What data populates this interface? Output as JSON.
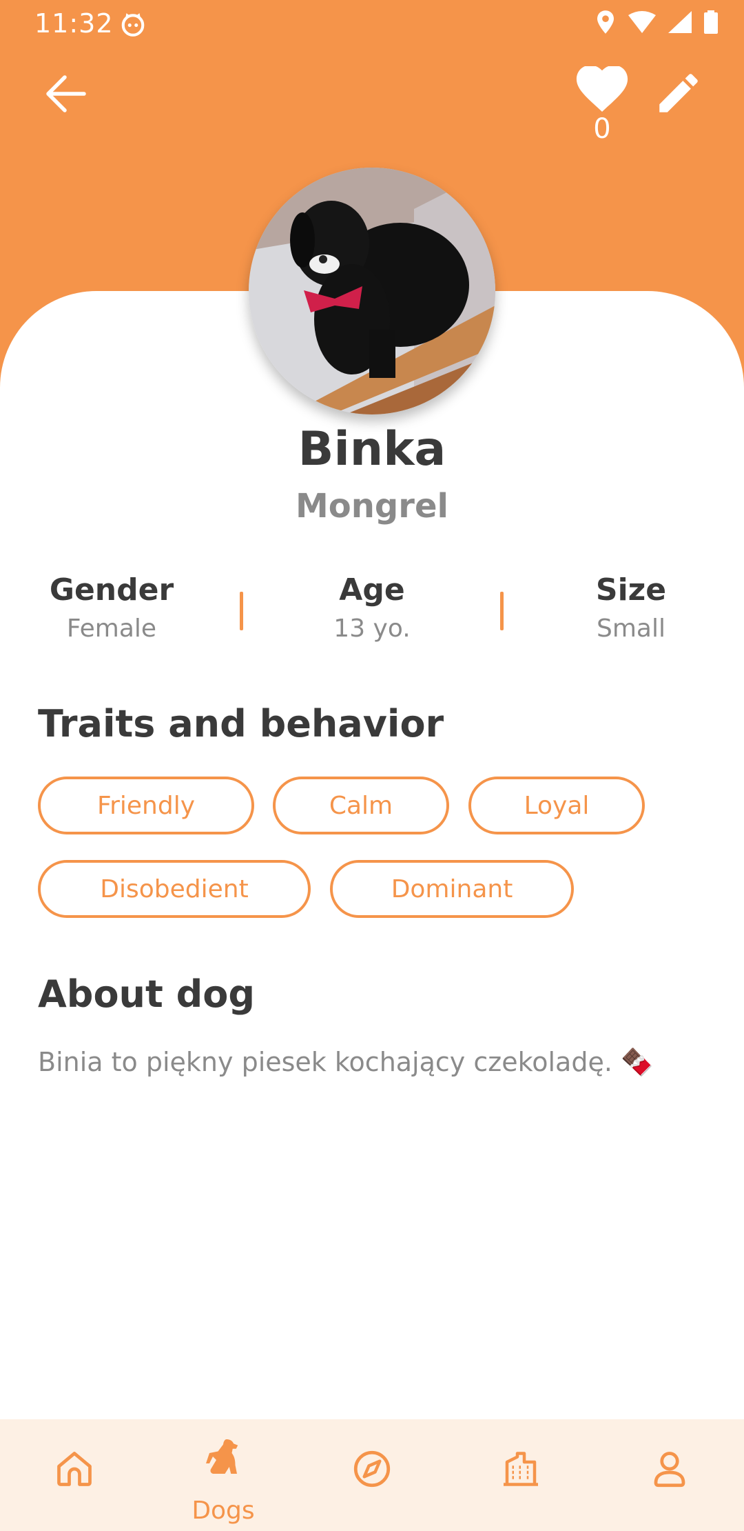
{
  "status_bar": {
    "time": "11:32"
  },
  "header": {
    "favorites_count": "0"
  },
  "dog": {
    "name": "Binka",
    "breed": "Mongrel"
  },
  "stats": [
    {
      "label": "Gender",
      "value": "Female"
    },
    {
      "label": "Age",
      "value": "13 yo."
    },
    {
      "label": "Size",
      "value": "Small"
    }
  ],
  "traits": {
    "title": "Traits and behavior",
    "items": [
      "Friendly",
      "Calm",
      "Loyal",
      "Disobedient",
      "Dominant"
    ]
  },
  "about": {
    "title": "About dog",
    "text": "Binia to piękny piesek kochający czekoladę. 🍫"
  },
  "bottom_nav": {
    "items": [
      {
        "icon": "home-icon",
        "label": ""
      },
      {
        "icon": "dog-icon",
        "label": "Dogs",
        "active": true
      },
      {
        "icon": "compass-icon",
        "label": ""
      },
      {
        "icon": "building-icon",
        "label": ""
      },
      {
        "icon": "person-icon",
        "label": ""
      }
    ]
  },
  "colors": {
    "accent": "#f5944a",
    "nav_bg": "#fdf0e4",
    "text_dark": "#3a3a3a",
    "text_muted": "#8a8a8a"
  }
}
